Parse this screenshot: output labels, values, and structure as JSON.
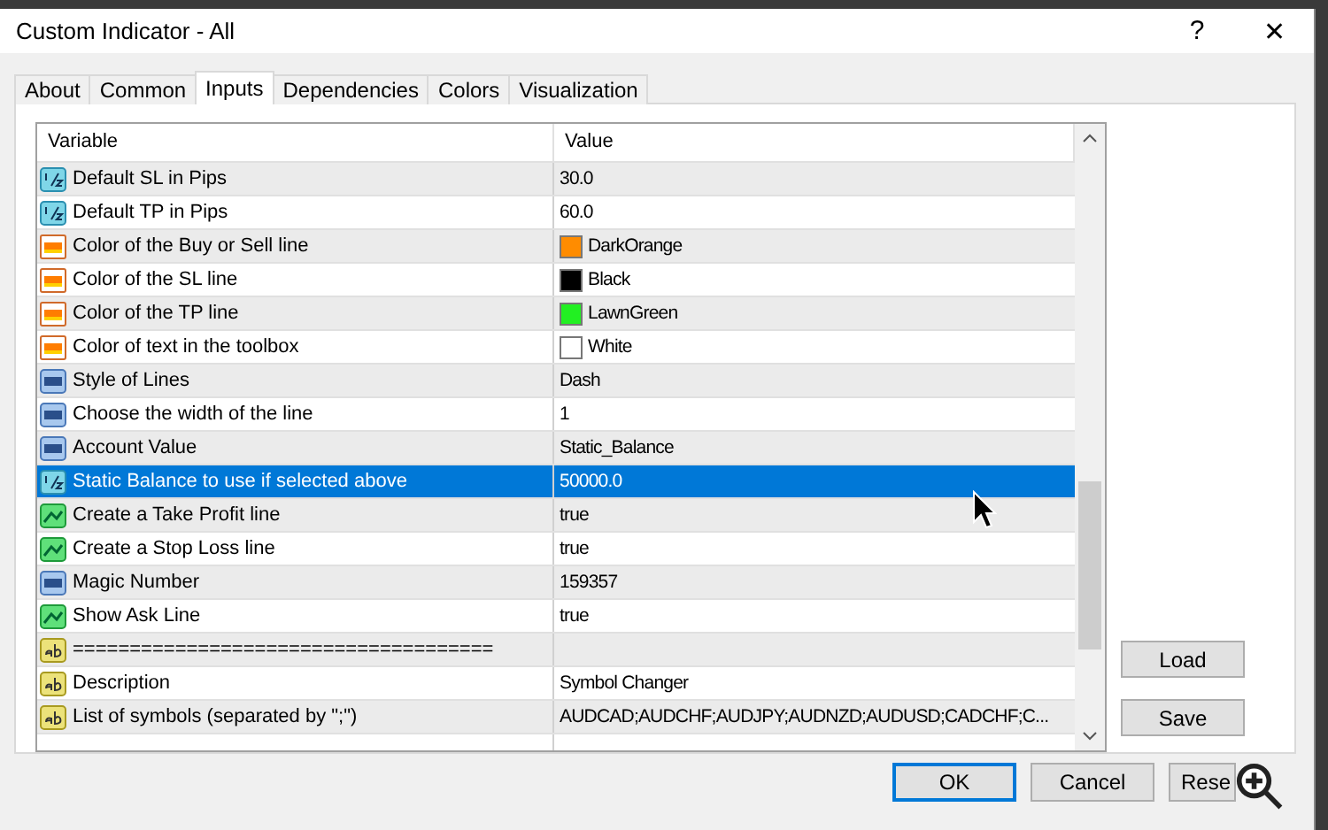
{
  "window": {
    "title": "Custom Indicator - All",
    "help": "?",
    "close": "✕"
  },
  "tabs": [
    {
      "label": "About",
      "selected": false
    },
    {
      "label": "Common",
      "selected": false
    },
    {
      "label": "Inputs",
      "selected": true
    },
    {
      "label": "Dependencies",
      "selected": false
    },
    {
      "label": "Colors",
      "selected": false
    },
    {
      "label": "Visualization",
      "selected": false
    }
  ],
  "table": {
    "columns": [
      "Variable",
      "Value"
    ],
    "rows": [
      {
        "kind": "double",
        "variable": "Default SL in Pips",
        "value": "30.0",
        "selected": false
      },
      {
        "kind": "double",
        "variable": "Default TP in Pips",
        "value": "60.0",
        "selected": false
      },
      {
        "kind": "color",
        "variable": "Color of the Buy or Sell line",
        "value": "DarkOrange",
        "color": "#ff8c00",
        "selected": false
      },
      {
        "kind": "color",
        "variable": "Color of the SL line",
        "value": "Black",
        "color": "#000000",
        "selected": false
      },
      {
        "kind": "color",
        "variable": "Color of the TP line",
        "value": "LawnGreen",
        "color": "#22f022",
        "selected": false
      },
      {
        "kind": "color",
        "variable": "Color of text in the toolbox",
        "value": "White",
        "color": "#ffffff",
        "selected": false
      },
      {
        "kind": "int",
        "variable": "Style of Lines",
        "value": "Dash",
        "selected": false
      },
      {
        "kind": "int",
        "variable": "Choose the width of the line",
        "value": "1",
        "selected": false
      },
      {
        "kind": "int",
        "variable": "Account Value",
        "value": "Static_Balance",
        "selected": false
      },
      {
        "kind": "double",
        "variable": "Static Balance to use if selected above",
        "value": "50000.0",
        "selected": true
      },
      {
        "kind": "bool",
        "variable": "Create a Take Profit line",
        "value": "true",
        "selected": false
      },
      {
        "kind": "bool",
        "variable": "Create a Stop Loss line",
        "value": "true",
        "selected": false
      },
      {
        "kind": "int",
        "variable": "Magic Number",
        "value": "159357",
        "selected": false
      },
      {
        "kind": "bool",
        "variable": "Show Ask Line",
        "value": "true",
        "selected": false
      },
      {
        "kind": "string",
        "variable": "=====================================",
        "selected": false
      },
      {
        "kind": "string",
        "variable": "Description",
        "value": "Symbol Changer",
        "selected": false
      },
      {
        "kind": "string",
        "variable": "List of symbols (separated by \";\")",
        "value": "AUDCAD;AUDCHF;AUDJPY;AUDNZD;AUDUSD;CADCHF;C...",
        "selected": false
      }
    ]
  },
  "side_buttons": [
    "Load",
    "Save"
  ],
  "buttons": [
    {
      "label": "OK",
      "default": true
    },
    {
      "label": "Cancel",
      "default": false
    },
    {
      "label": "Rese",
      "default": false
    }
  ]
}
